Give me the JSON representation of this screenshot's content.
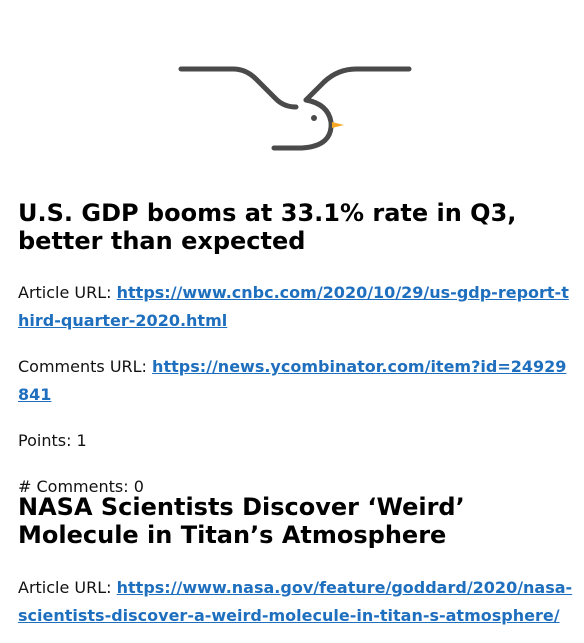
{
  "colors": {
    "link": "#1f6fbf",
    "logo_stroke": "#4a4a4a",
    "logo_beak": "#f5a623"
  },
  "logo": {
    "icon": "bird-logo-icon"
  },
  "articles": [
    {
      "title": "U.S. GDP booms at 33.1% rate in Q3, better than expected",
      "article_url_label": "Article URL:",
      "article_url": "https://www.cnbc.com/2020/10/29/us-gdp-report-third-quarter-2020.html",
      "comments_url_label": "Comments URL:",
      "comments_url": "https://news.ycombinator.com/item?id=24929841",
      "points_label": "Points: 1",
      "comments_count_label": "# Comments: 0"
    },
    {
      "title": "NASA Scientists Discover ‘Weird’ Molecule in Titan’s Atmosphere",
      "article_url_label": "Article URL:",
      "article_url": "https://www.nasa.gov/feature/goddard/2020/nasa-scientists-discover-a-weird-molecule-in-titan-s-atmosphere/"
    }
  ]
}
